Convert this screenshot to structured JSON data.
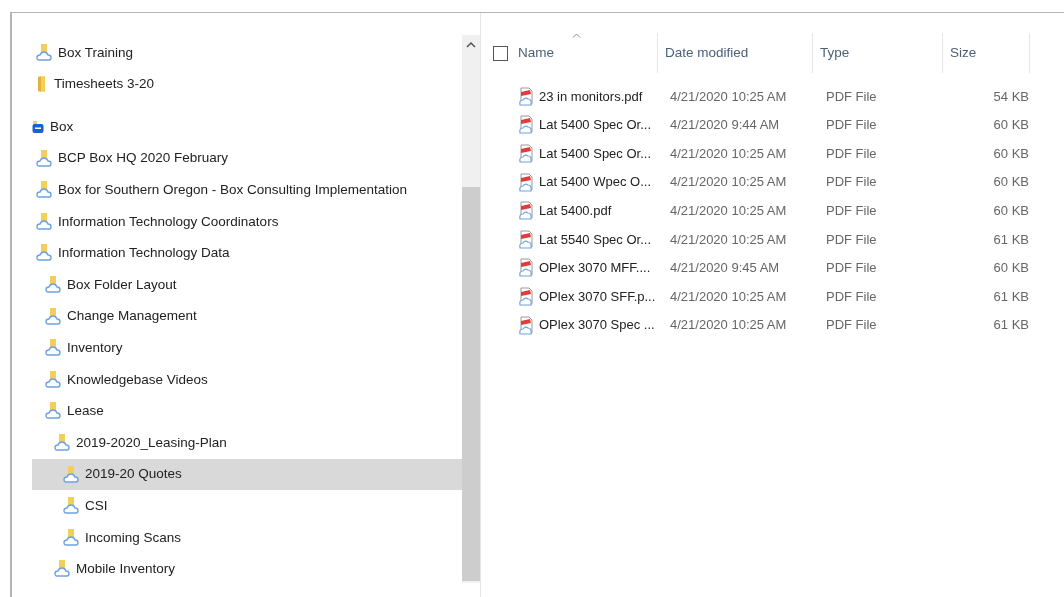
{
  "tree": [
    {
      "label": "Box Training",
      "kind": "box-folder",
      "selected": false
    },
    {
      "label": "Timesheets 3-20",
      "kind": "folder",
      "selected": false
    },
    {
      "label": "Box",
      "kind": "box",
      "selected": false
    },
    {
      "label": "BCP Box HQ 2020 February",
      "kind": "box-folder",
      "selected": false
    },
    {
      "label": "Box for Southern Oregon - Box Consulting Implementation",
      "kind": "box-folder",
      "selected": false
    },
    {
      "label": "Information Technology Coordinators",
      "kind": "box-folder",
      "selected": false
    },
    {
      "label": "Information Technology Data",
      "kind": "box-folder",
      "selected": false,
      "children": [
        {
          "label": "Box Folder Layout",
          "kind": "box-folder",
          "selected": false
        },
        {
          "label": "Change Management",
          "kind": "box-folder",
          "selected": false
        },
        {
          "label": "Inventory",
          "kind": "box-folder",
          "selected": false
        },
        {
          "label": "Knowledgebase Videos",
          "kind": "box-folder",
          "selected": false
        },
        {
          "label": "Lease",
          "kind": "box-folder",
          "selected": false,
          "children": [
            {
              "label": "2019-2020_Leasing-Plan",
              "kind": "box-folder",
              "selected": false,
              "children": [
                {
                  "label": "2019-20 Quotes",
                  "kind": "box-folder",
                  "selected": true
                },
                {
                  "label": "CSI",
                  "kind": "box-folder",
                  "selected": false
                },
                {
                  "label": "Incoming Scans",
                  "kind": "box-folder",
                  "selected": false
                }
              ]
            },
            {
              "label": "Mobile Inventory",
              "kind": "box-folder",
              "selected": false
            }
          ]
        }
      ]
    }
  ],
  "files": {
    "select_all_checked": false,
    "columns": [
      "Name",
      "Date modified",
      "Type",
      "Size"
    ],
    "rows": [
      [
        "23 in monitors.pdf",
        "4/21/2020 10:25 AM",
        "PDF File",
        "54 KB"
      ],
      [
        "Lat 5400 Spec Or...",
        "4/21/2020 9:44 AM",
        "PDF File",
        "60 KB"
      ],
      [
        "Lat 5400 Spec Or...",
        "4/21/2020 10:25 AM",
        "PDF File",
        "60 KB"
      ],
      [
        "Lat 5400 Wpec O...",
        "4/21/2020 10:25 AM",
        "PDF File",
        "60 KB"
      ],
      [
        "Lat 5400.pdf",
        "4/21/2020 10:25 AM",
        "PDF File",
        "60 KB"
      ],
      [
        "Lat 5540 Spec Or...",
        "4/21/2020 10:25 AM",
        "PDF File",
        "61 KB"
      ],
      [
        "OPlex 3070 MFF....",
        "4/21/2020 9:45 AM",
        "PDF File",
        "60 KB"
      ],
      [
        "OPlex 3070 SFF.p...",
        "4/21/2020 10:25 AM",
        "PDF File",
        "61 KB"
      ],
      [
        "OPlex 3070 Spec ...",
        "4/21/2020 10:25 AM",
        "PDF File",
        "61 KB"
      ]
    ]
  }
}
